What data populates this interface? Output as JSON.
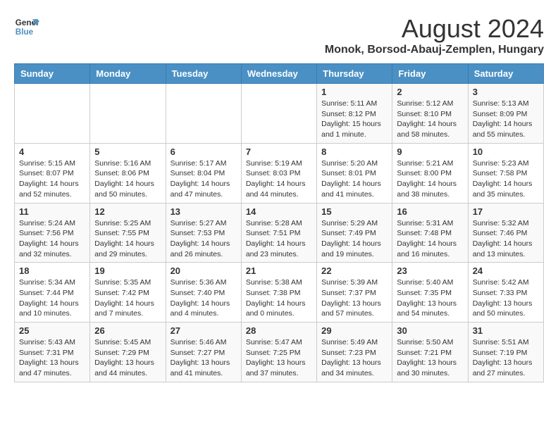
{
  "header": {
    "logo": {
      "line1": "General",
      "line2": "Blue"
    },
    "title": "August 2024",
    "subtitle": "Monok, Borsod-Abauj-Zemplen, Hungary"
  },
  "days_of_week": [
    "Sunday",
    "Monday",
    "Tuesday",
    "Wednesday",
    "Thursday",
    "Friday",
    "Saturday"
  ],
  "weeks": [
    [
      {
        "day": "",
        "info": ""
      },
      {
        "day": "",
        "info": ""
      },
      {
        "day": "",
        "info": ""
      },
      {
        "day": "",
        "info": ""
      },
      {
        "day": "1",
        "info": "Sunrise: 5:11 AM\nSunset: 8:12 PM\nDaylight: 15 hours and 1 minute."
      },
      {
        "day": "2",
        "info": "Sunrise: 5:12 AM\nSunset: 8:10 PM\nDaylight: 14 hours and 58 minutes."
      },
      {
        "day": "3",
        "info": "Sunrise: 5:13 AM\nSunset: 8:09 PM\nDaylight: 14 hours and 55 minutes."
      }
    ],
    [
      {
        "day": "4",
        "info": "Sunrise: 5:15 AM\nSunset: 8:07 PM\nDaylight: 14 hours and 52 minutes."
      },
      {
        "day": "5",
        "info": "Sunrise: 5:16 AM\nSunset: 8:06 PM\nDaylight: 14 hours and 50 minutes."
      },
      {
        "day": "6",
        "info": "Sunrise: 5:17 AM\nSunset: 8:04 PM\nDaylight: 14 hours and 47 minutes."
      },
      {
        "day": "7",
        "info": "Sunrise: 5:19 AM\nSunset: 8:03 PM\nDaylight: 14 hours and 44 minutes."
      },
      {
        "day": "8",
        "info": "Sunrise: 5:20 AM\nSunset: 8:01 PM\nDaylight: 14 hours and 41 minutes."
      },
      {
        "day": "9",
        "info": "Sunrise: 5:21 AM\nSunset: 8:00 PM\nDaylight: 14 hours and 38 minutes."
      },
      {
        "day": "10",
        "info": "Sunrise: 5:23 AM\nSunset: 7:58 PM\nDaylight: 14 hours and 35 minutes."
      }
    ],
    [
      {
        "day": "11",
        "info": "Sunrise: 5:24 AM\nSunset: 7:56 PM\nDaylight: 14 hours and 32 minutes."
      },
      {
        "day": "12",
        "info": "Sunrise: 5:25 AM\nSunset: 7:55 PM\nDaylight: 14 hours and 29 minutes."
      },
      {
        "day": "13",
        "info": "Sunrise: 5:27 AM\nSunset: 7:53 PM\nDaylight: 14 hours and 26 minutes."
      },
      {
        "day": "14",
        "info": "Sunrise: 5:28 AM\nSunset: 7:51 PM\nDaylight: 14 hours and 23 minutes."
      },
      {
        "day": "15",
        "info": "Sunrise: 5:29 AM\nSunset: 7:49 PM\nDaylight: 14 hours and 19 minutes."
      },
      {
        "day": "16",
        "info": "Sunrise: 5:31 AM\nSunset: 7:48 PM\nDaylight: 14 hours and 16 minutes."
      },
      {
        "day": "17",
        "info": "Sunrise: 5:32 AM\nSunset: 7:46 PM\nDaylight: 14 hours and 13 minutes."
      }
    ],
    [
      {
        "day": "18",
        "info": "Sunrise: 5:34 AM\nSunset: 7:44 PM\nDaylight: 14 hours and 10 minutes."
      },
      {
        "day": "19",
        "info": "Sunrise: 5:35 AM\nSunset: 7:42 PM\nDaylight: 14 hours and 7 minutes."
      },
      {
        "day": "20",
        "info": "Sunrise: 5:36 AM\nSunset: 7:40 PM\nDaylight: 14 hours and 4 minutes."
      },
      {
        "day": "21",
        "info": "Sunrise: 5:38 AM\nSunset: 7:38 PM\nDaylight: 14 hours and 0 minutes."
      },
      {
        "day": "22",
        "info": "Sunrise: 5:39 AM\nSunset: 7:37 PM\nDaylight: 13 hours and 57 minutes."
      },
      {
        "day": "23",
        "info": "Sunrise: 5:40 AM\nSunset: 7:35 PM\nDaylight: 13 hours and 54 minutes."
      },
      {
        "day": "24",
        "info": "Sunrise: 5:42 AM\nSunset: 7:33 PM\nDaylight: 13 hours and 50 minutes."
      }
    ],
    [
      {
        "day": "25",
        "info": "Sunrise: 5:43 AM\nSunset: 7:31 PM\nDaylight: 13 hours and 47 minutes."
      },
      {
        "day": "26",
        "info": "Sunrise: 5:45 AM\nSunset: 7:29 PM\nDaylight: 13 hours and 44 minutes."
      },
      {
        "day": "27",
        "info": "Sunrise: 5:46 AM\nSunset: 7:27 PM\nDaylight: 13 hours and 41 minutes."
      },
      {
        "day": "28",
        "info": "Sunrise: 5:47 AM\nSunset: 7:25 PM\nDaylight: 13 hours and 37 minutes."
      },
      {
        "day": "29",
        "info": "Sunrise: 5:49 AM\nSunset: 7:23 PM\nDaylight: 13 hours and 34 minutes."
      },
      {
        "day": "30",
        "info": "Sunrise: 5:50 AM\nSunset: 7:21 PM\nDaylight: 13 hours and 30 minutes."
      },
      {
        "day": "31",
        "info": "Sunrise: 5:51 AM\nSunset: 7:19 PM\nDaylight: 13 hours and 27 minutes."
      }
    ]
  ]
}
